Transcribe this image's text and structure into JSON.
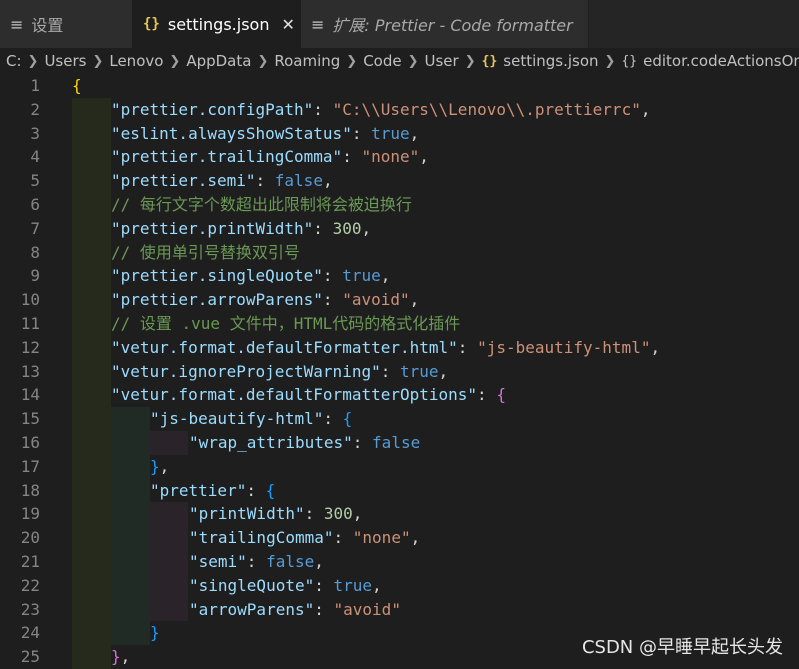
{
  "tabs": [
    {
      "label": "设置",
      "icon": "menu-icon"
    },
    {
      "label": "settings.json",
      "icon": "json-braces-icon",
      "close": "✕"
    },
    {
      "label": "扩展: Prettier - Code formatter",
      "icon": "menu-icon"
    }
  ],
  "breadcrumb": [
    "C:",
    "Users",
    "Lenovo",
    "AppData",
    "Roaming",
    "Code",
    "User",
    "settings.json",
    "editor.codeActionsOnSave"
  ],
  "editor": {
    "line_numbers": [
      "1",
      "2",
      "3",
      "4",
      "5",
      "6",
      "7",
      "8",
      "9",
      "10",
      "11",
      "12",
      "13",
      "14",
      "15",
      "16",
      "17",
      "18",
      "19",
      "20",
      "21",
      "22",
      "23",
      "24",
      "25"
    ],
    "lines": [
      "{",
      "\"prettier.configPath\": \"C:\\\\Users\\\\Lenovo\\\\.prettierrc\",",
      "\"eslint.alwaysShowStatus\": true,",
      "\"prettier.trailingComma\": \"none\",",
      "\"prettier.semi\": false,",
      "// 每行文字个数超出此限制将会被迫换行",
      "\"prettier.printWidth\": 300,",
      "// 使用单引号替换双引号",
      "\"prettier.singleQuote\": true,",
      "\"prettier.arrowParens\": \"avoid\",",
      "// 设置 .vue 文件中，HTML代码的格式化插件",
      "\"vetur.format.defaultFormatter.html\": \"js-beautify-html\",",
      "\"vetur.ignoreProjectWarning\": true,",
      "\"vetur.format.defaultFormatterOptions\": {",
      "\"js-beautify-html\": {",
      "\"wrap_attributes\": false",
      "},",
      "\"prettier\": {",
      "\"printWidth\": 300,",
      "\"trailingComma\": \"none\",",
      "\"semi\": false,",
      "\"singleQuote\": true,",
      "\"arrowParens\": \"avoid\"",
      "}",
      "},"
    ]
  },
  "watermark": "CSDN @早睡早起长头发",
  "colors": {
    "key": "#9cdcfe",
    "string": "#ce9178",
    "number": "#b5cea8",
    "boolean": "#569cd6",
    "comment": "#6a9955",
    "bracket_level1": "#ffd700",
    "bracket_level2": "#da70d6",
    "bracket_level3": "#179fff"
  }
}
